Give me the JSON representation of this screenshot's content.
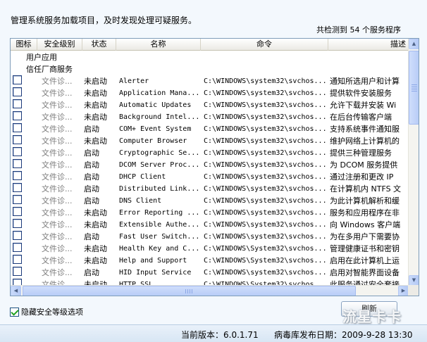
{
  "description": "管理系统服务加载项目，及时发现处理可疑服务。",
  "count_text": "共检测到 54 个服务程序",
  "columns": [
    "图标",
    "安全级别",
    "状态",
    "名称",
    "命令",
    "描述"
  ],
  "groups": [
    "用户应用",
    "信任厂商服务"
  ],
  "rows": [
    {
      "level": "文件诊...",
      "status": "未启动",
      "name": "Alerter",
      "cmd": "C:\\WINDOWS\\system32\\svchos...",
      "desc": "通知所选用户和计算"
    },
    {
      "level": "文件诊...",
      "status": "未启动",
      "name": "Application Mana...",
      "cmd": "C:\\WINDOWS\\system32\\svchos...",
      "desc": "提供软件安装服务"
    },
    {
      "level": "文件诊...",
      "status": "未启动",
      "name": "Automatic Updates",
      "cmd": "C:\\WINDOWS\\system32\\svchos...",
      "desc": "允许下载并安装 Wi"
    },
    {
      "level": "文件诊...",
      "status": "未启动",
      "name": "Background Intel...",
      "cmd": "C:\\WINDOWS\\system32\\svchos...",
      "desc": "在后台传输客户端"
    },
    {
      "level": "文件诊...",
      "status": "启动",
      "name": "COM+ Event System",
      "cmd": "C:\\WINDOWS\\system32\\svchos...",
      "desc": "支持系统事件通知服"
    },
    {
      "level": "文件诊...",
      "status": "未启动",
      "name": "Computer Browser",
      "cmd": "C:\\WINDOWS\\system32\\svchos...",
      "desc": "维护网络上计算机的"
    },
    {
      "level": "文件诊...",
      "status": "启动",
      "name": "Cryptographic Se...",
      "cmd": "C:\\WINDOWS\\system32\\svchos...",
      "desc": "提供三种管理服务"
    },
    {
      "level": "文件诊...",
      "status": "启动",
      "name": "DCOM Server Proc...",
      "cmd": "C:\\WINDOWS\\system32\\svchos...",
      "desc": "为 DCOM 服务提供"
    },
    {
      "level": "文件诊...",
      "status": "启动",
      "name": "DHCP Client",
      "cmd": "C:\\WINDOWS\\system32\\svchos...",
      "desc": "通过注册和更改 IP"
    },
    {
      "level": "文件诊...",
      "status": "启动",
      "name": "Distributed Link...",
      "cmd": "C:\\WINDOWS\\system32\\svchos...",
      "desc": "在计算机内 NTFS 文"
    },
    {
      "level": "文件诊...",
      "status": "启动",
      "name": "DNS Client",
      "cmd": "C:\\WINDOWS\\system32\\svchos...",
      "desc": "为此计算机解析和缓"
    },
    {
      "level": "文件诊...",
      "status": "未启动",
      "name": "Error Reporting ...",
      "cmd": "C:\\WINDOWS\\system32\\svchos...",
      "desc": "服务和应用程序在非"
    },
    {
      "level": "文件诊...",
      "status": "未启动",
      "name": "Extensible Authe...",
      "cmd": "C:\\WINDOWS\\system32\\svchos...",
      "desc": "向 Windows 客户端"
    },
    {
      "level": "文件诊...",
      "status": "启动",
      "name": "Fast User Switch...",
      "cmd": "C:\\WINDOWS\\system32\\svchos...",
      "desc": "为在多用户下需要协"
    },
    {
      "level": "文件诊...",
      "status": "未启动",
      "name": "Health Key and C...",
      "cmd": "C:\\WINDOWS\\System32\\svchos...",
      "desc": "管理健康证书和密钥"
    },
    {
      "level": "文件诊...",
      "status": "未启动",
      "name": "Help and Support",
      "cmd": "C:\\WINDOWS\\System32\\svchos...",
      "desc": "启用在此计算机上运"
    },
    {
      "level": "文件诊...",
      "status": "启动",
      "name": "HID Input Service",
      "cmd": "C:\\WINDOWS\\system32\\svchos...",
      "desc": "启用对智能界面设备"
    },
    {
      "level": "文件诊...",
      "status": "未启动",
      "name": "HTTP SSL",
      "cmd": "C:\\WINDOWS\\System32\\svchos...",
      "desc": "此服务通过安全套接"
    }
  ],
  "hide_option_label": "隐藏安全等级选项",
  "hide_option_checked": true,
  "refresh_label": "刷新",
  "version_text": "当前版本：6.0.1.71",
  "db_date_text": "病毒库发布日期：2009-9-28 13:30",
  "watermark": "流星卡卡"
}
